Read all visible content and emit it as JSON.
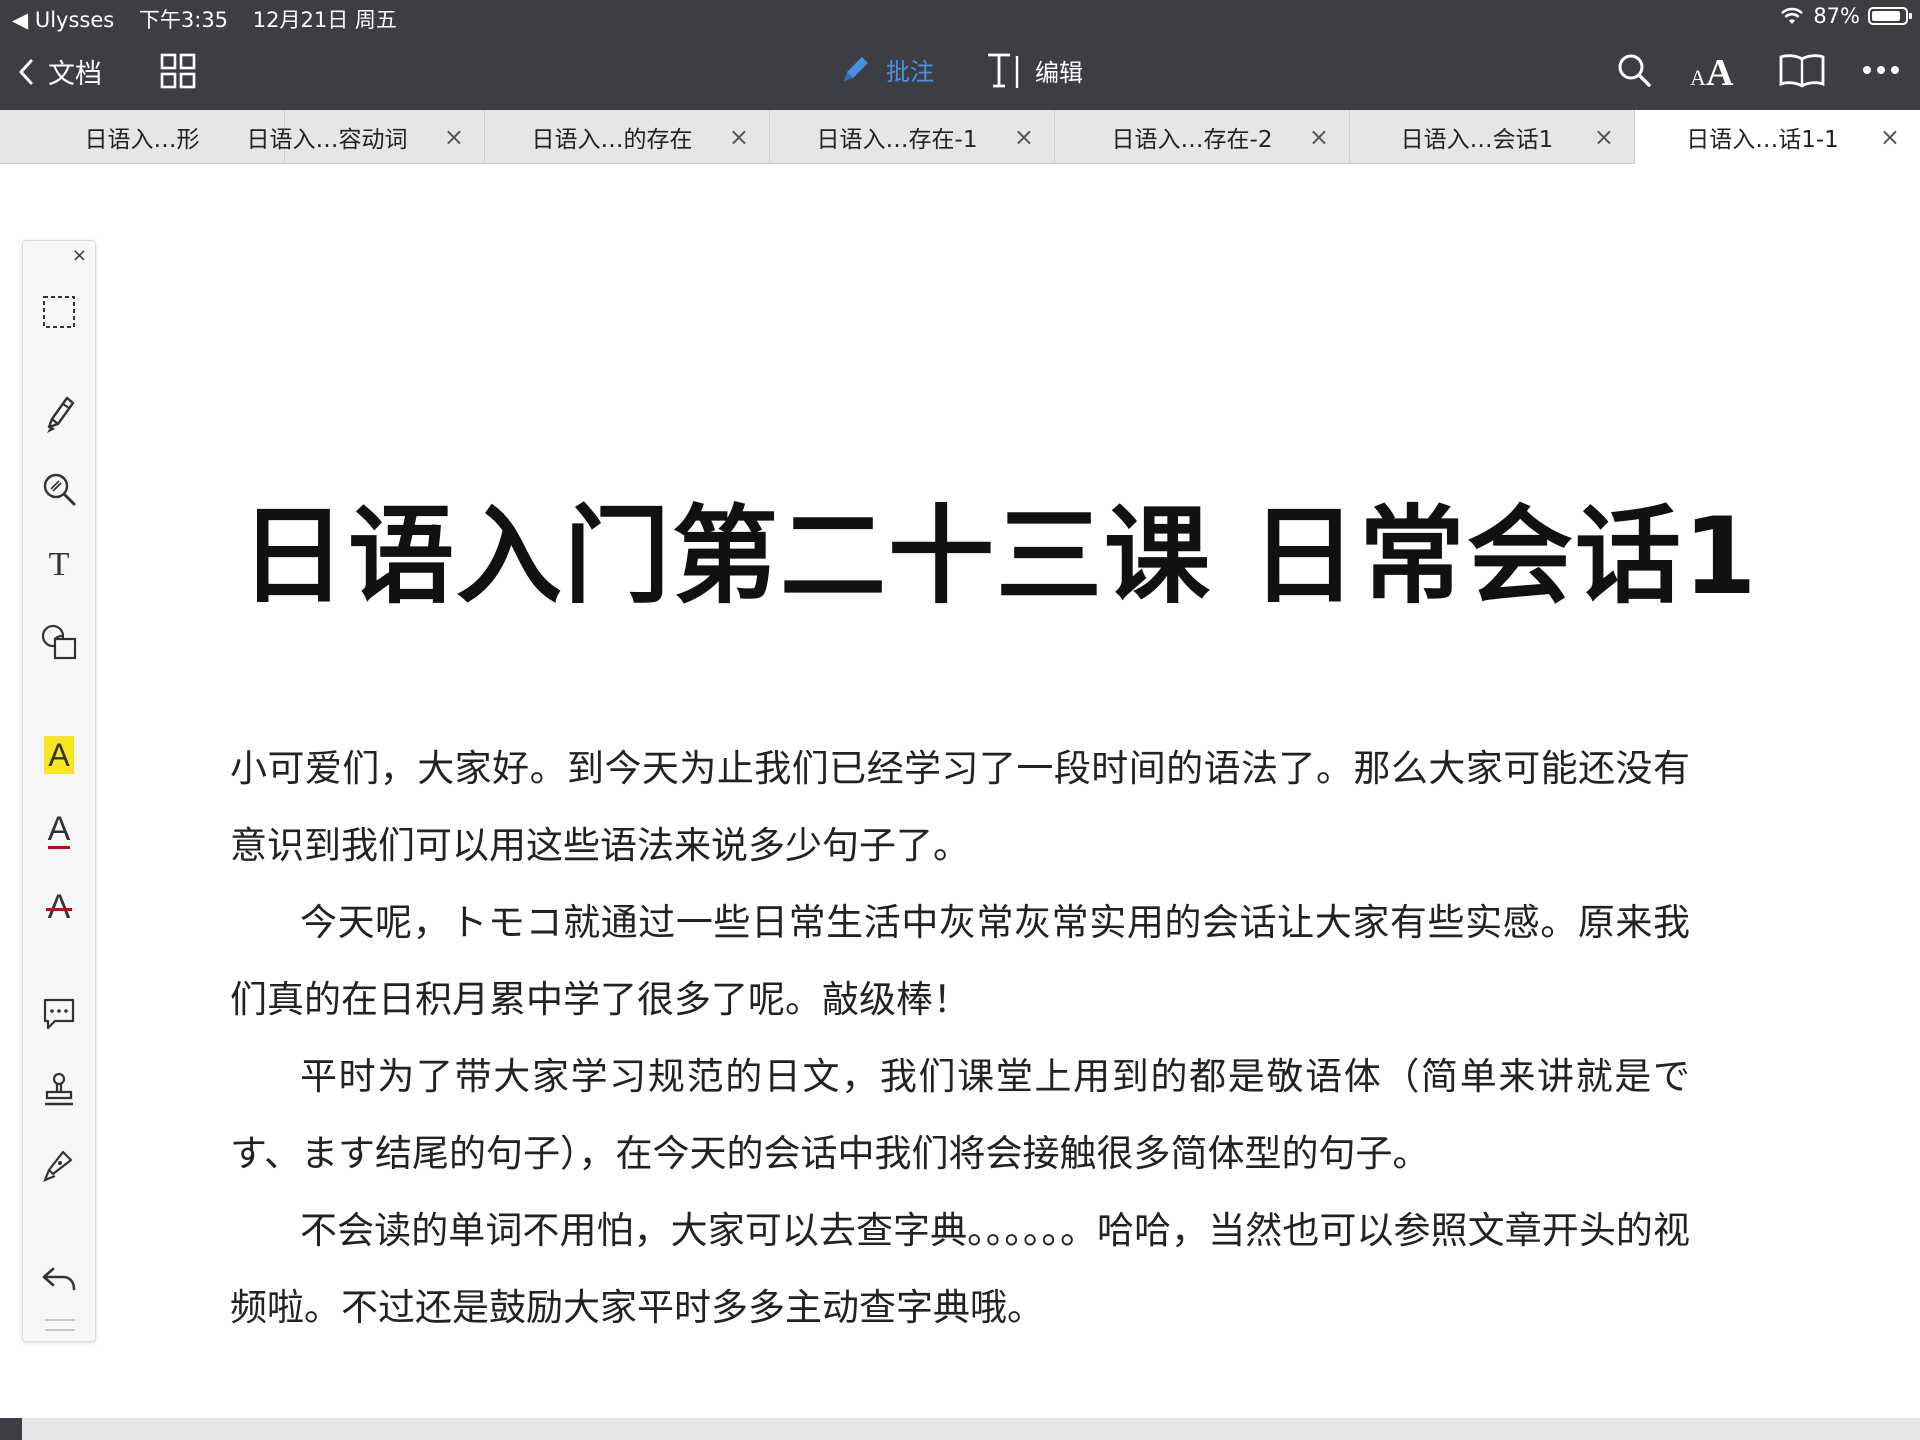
{
  "status": {
    "back_app": "◀ Ulysses",
    "time": "下午3:35",
    "date": "12月21日 周五",
    "battery": "87%",
    "battery_level": 0.87
  },
  "toolbar": {
    "back_label": "文档",
    "annotate_label": "批注",
    "edit_label": "编辑",
    "accent_color": "#4a90e2"
  },
  "tabs": [
    {
      "label": "日语入…形"
    },
    {
      "label": "日语入…容动词",
      "close": "×"
    },
    {
      "label": "日语入…的存在",
      "close": "×"
    },
    {
      "label": "日语入…存在-1",
      "close": "×"
    },
    {
      "label": "日语入…存在-2",
      "close": "×"
    },
    {
      "label": "日语入…会话1",
      "close": "×"
    },
    {
      "label": "日语入…话1-1",
      "close": "×",
      "active": true
    }
  ],
  "tools": {
    "close": "×",
    "text_tool": "T",
    "highlight": "A",
    "underline": "A",
    "strikethrough": "A",
    "highlight_color": "#f8e71c",
    "mark_color": "#d0021b"
  },
  "document": {
    "title": "日语入门第二十三课 日常会话1",
    "paragraphs": [
      "小可爱们，大家好。到今天为止我们已经学习了一段时间的语法了。那么大家可能还没有意识到我们可以用这些语法来说多少句子了。",
      "今天呢，トモコ就通过一些日常生活中灰常灰常实用的会话让大家有些实感。原来我们真的在日积月累中学了很多了呢。敲级棒！",
      "平时为了带大家学习规范的日文，我们课堂上用到的都是敬语体（简单来讲就是です、ます结尾的句子），在今天的会话中我们将会接触很多简体型的句子。",
      "不会读的单词不用怕，大家可以去查字典。。。。。。哈哈，当然也可以参照文章开头的视频啦。不过还是鼓励大家平时多多主动查字典哦。"
    ]
  }
}
